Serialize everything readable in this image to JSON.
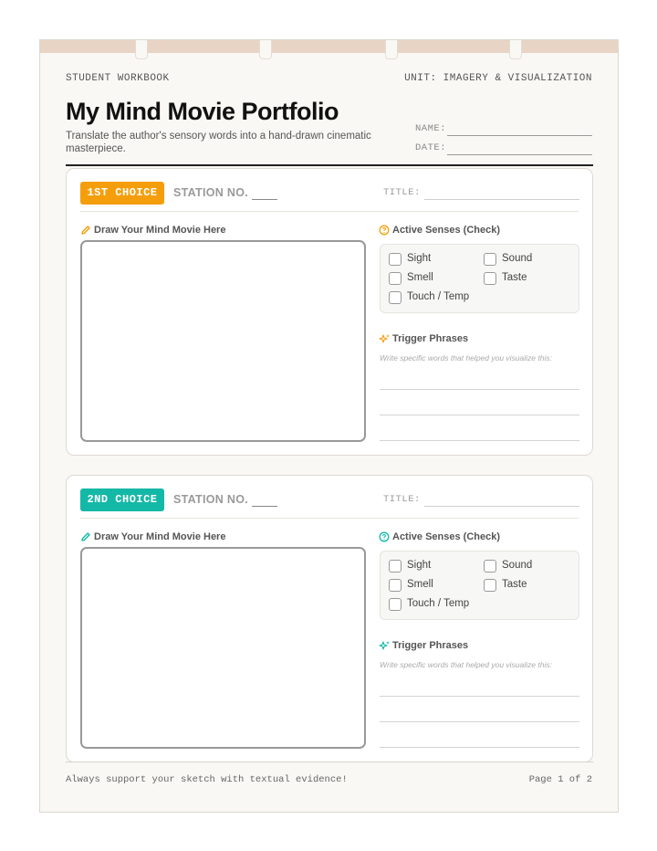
{
  "header": {
    "workbook_label": "STUDENT WORKBOOK",
    "unit_label": "UNIT: IMAGERY & VISUALIZATION",
    "title": "My Mind Movie Portfolio",
    "subtitle": "Translate the author's sensory words into a hand-drawn cinematic masterpiece.",
    "name_label": "NAME:",
    "date_label": "DATE:"
  },
  "colors": {
    "choice1_accent": "#f59e0b",
    "choice2_accent": "#14b8a6",
    "top_band": "#e8d4c4"
  },
  "cards": [
    {
      "badge": "1ST CHOICE",
      "station_label": "STATION NO.",
      "title_label": "TITLE:",
      "draw_label": "Draw Your Mind Movie Here",
      "draw_icon": "pencil-icon",
      "senses_label": "Active Senses (Check)",
      "senses_icon": "question-circle-icon",
      "senses": [
        "Sight",
        "Sound",
        "Smell",
        "Taste",
        "Touch / Temp"
      ],
      "trigger_label": "Trigger Phrases",
      "trigger_icon": "sparkle-icon",
      "trigger_hint": "Write specific words that helped you visualize this:"
    },
    {
      "badge": "2ND CHOICE",
      "station_label": "STATION NO.",
      "title_label": "TITLE:",
      "draw_label": "Draw Your Mind Movie Here",
      "draw_icon": "pencil-icon",
      "senses_label": "Active Senses (Check)",
      "senses_icon": "question-circle-icon",
      "senses": [
        "Sight",
        "Sound",
        "Smell",
        "Taste",
        "Touch / Temp"
      ],
      "trigger_label": "Trigger Phrases",
      "trigger_icon": "sparkle-icon",
      "trigger_hint": "Write specific words that helped you visualize this:"
    }
  ],
  "footer": {
    "note": "Always support your sketch with textual evidence!",
    "page": "Page 1 of 2"
  }
}
